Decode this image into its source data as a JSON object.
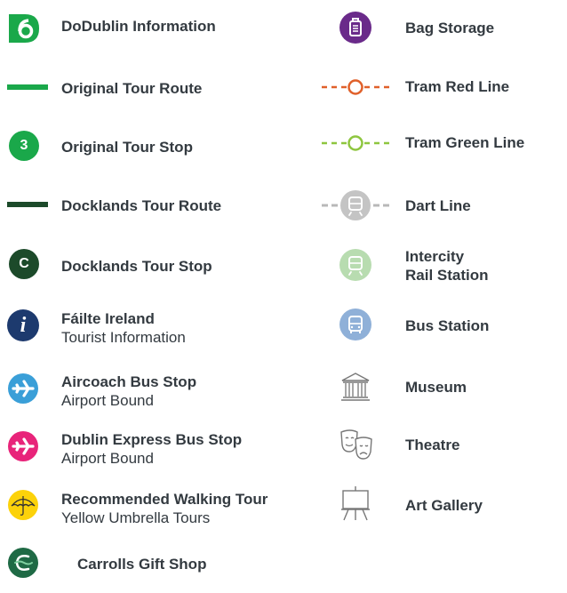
{
  "colors": {
    "original_green": "#1aa84a",
    "docklands_green": "#1c4a2a",
    "failte_blue": "#1d3a6e",
    "aircoach_blue": "#3a9fd8",
    "dublin_express_pink": "#e8247a",
    "umbrella_yellow": "#fcd20a",
    "carrolls_green": "#1f6a45",
    "bag_purple": "#6a2a8a",
    "tram_red": "#e0602a",
    "tram_green": "#8ec63f",
    "dart_grey": "#b8b8b8",
    "intercity_green": "#b8dcb0",
    "bus_blue": "#8fb0d8",
    "icon_grey": "#777777"
  },
  "left": [
    {
      "key": "dodublin",
      "icon": "dodublin-logo-icon",
      "main": "DoDublin Information",
      "sub": ""
    },
    {
      "key": "original-route",
      "icon": "green-line-icon",
      "main": "Original Tour Route",
      "sub": ""
    },
    {
      "key": "original-stop",
      "icon": "stop-number-icon",
      "badge": "3",
      "main": "Original Tour Stop",
      "sub": ""
    },
    {
      "key": "docklands-route",
      "icon": "dark-green-line-icon",
      "main": "Docklands Tour Route",
      "sub": ""
    },
    {
      "key": "docklands-stop",
      "icon": "stop-letter-icon",
      "badge": "C",
      "main": "Docklands Tour Stop",
      "sub": ""
    },
    {
      "key": "failte",
      "icon": "info-icon",
      "badge": "i",
      "main": "Fáilte Ireland",
      "sub": "Tourist Information"
    },
    {
      "key": "aircoach",
      "icon": "airplane-icon",
      "main": "Aircoach Bus Stop",
      "sub": "Airport Bound"
    },
    {
      "key": "dublin-express",
      "icon": "airplane-icon",
      "main": "Dublin Express Bus Stop",
      "sub": "Airport Bound"
    },
    {
      "key": "walking-tour",
      "icon": "umbrella-icon",
      "main": "Recommended Walking Tour",
      "sub": "Yellow Umbrella Tours"
    },
    {
      "key": "carrolls",
      "icon": "carrolls-logo-icon",
      "main": "Carrolls Gift Shop",
      "sub": ""
    }
  ],
  "right": [
    {
      "key": "bag-storage",
      "icon": "suitcase-icon",
      "main": "Bag Storage",
      "sub": ""
    },
    {
      "key": "tram-red",
      "icon": "tram-red-line-icon",
      "main": "Tram Red Line",
      "sub": ""
    },
    {
      "key": "tram-green",
      "icon": "tram-green-line-icon",
      "main": "Tram Green Line",
      "sub": ""
    },
    {
      "key": "dart",
      "icon": "dart-train-icon",
      "main": "Dart Line",
      "sub": ""
    },
    {
      "key": "intercity",
      "icon": "train-icon",
      "main": "Intercity",
      "sub": "Rail Station"
    },
    {
      "key": "bus-station",
      "icon": "bus-icon",
      "main": "Bus Station",
      "sub": ""
    },
    {
      "key": "museum",
      "icon": "museum-icon",
      "main": "Museum",
      "sub": ""
    },
    {
      "key": "theatre",
      "icon": "theatre-masks-icon",
      "main": "Theatre",
      "sub": ""
    },
    {
      "key": "art-gallery",
      "icon": "easel-icon",
      "main": "Art Gallery",
      "sub": ""
    }
  ]
}
